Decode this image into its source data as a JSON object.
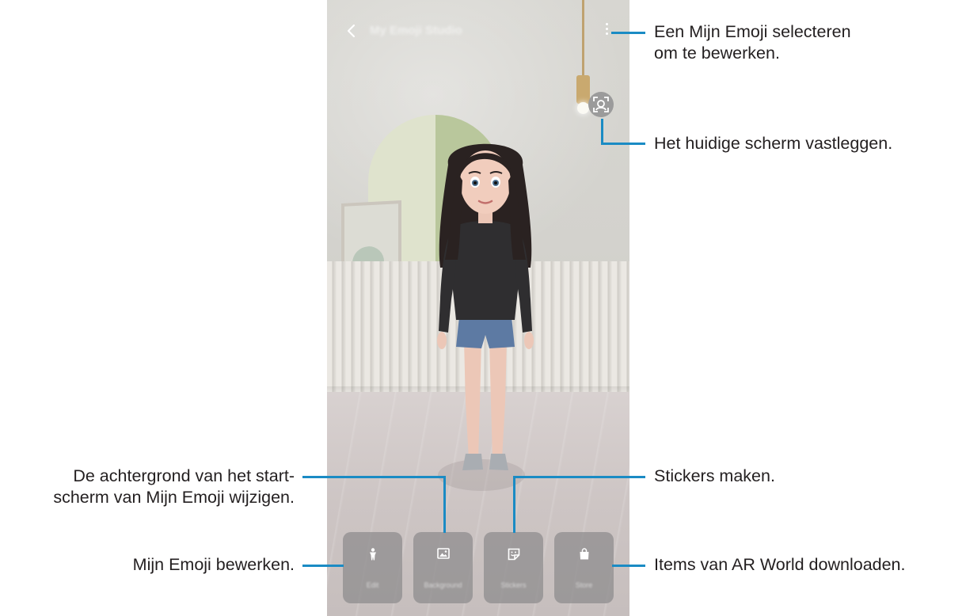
{
  "app": {
    "title": "My Emoji Studio",
    "back_icon": "chevron-left-icon",
    "more_icon": "more-vertical-icon",
    "capture_icon": "face-scan-icon"
  },
  "toolbar": {
    "buttons": [
      {
        "label": "Edit",
        "icon": "person-icon"
      },
      {
        "label": "Background",
        "icon": "image-icon"
      },
      {
        "label": "Stickers",
        "icon": "sticker-icon"
      },
      {
        "label": "Store",
        "icon": "shopping-bag-icon"
      }
    ]
  },
  "callouts": {
    "more_menu_line1": "Een Mijn Emoji selecteren",
    "more_menu_line2": "om te bewerken.",
    "capture": "Het huidige scherm vastleggen.",
    "background_line1": "De achtergrond van het start-",
    "background_line2": "scherm van Mijn Emoji wijzigen.",
    "stickers": "Stickers maken.",
    "edit": "Mijn Emoji bewerken.",
    "store": "Items van AR World downloaden."
  },
  "colors": {
    "callout_line": "#1a8bc4",
    "callout_text": "#231f20"
  }
}
